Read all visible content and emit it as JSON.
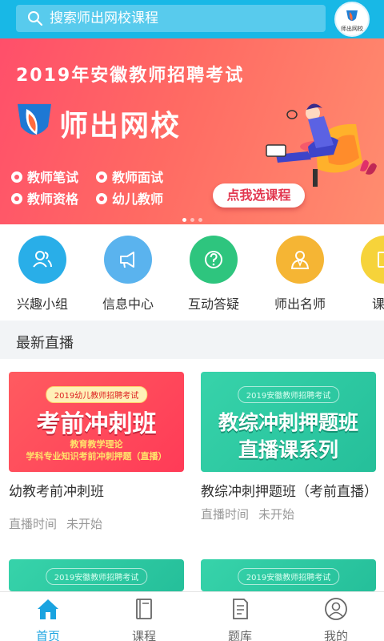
{
  "header": {
    "search_placeholder": "搜索师出网校课程",
    "avatar_text": "师出网校"
  },
  "banner": {
    "year_title": "2019年安徽教师招聘考试",
    "brand": "师出网校",
    "tags": [
      "教师笔试",
      "教师面试",
      "教师资格",
      "幼儿教师"
    ],
    "cta": "点我选课程",
    "page_count": 3,
    "active_page": 1
  },
  "categories": [
    {
      "label": "兴趣小组",
      "icon": "group-icon",
      "color": "#29aee8"
    },
    {
      "label": "信息中心",
      "icon": "megaphone-icon",
      "color": "#5ab3ee"
    },
    {
      "label": "互动答疑",
      "icon": "question-icon",
      "color": "#2ec57e"
    },
    {
      "label": "师出名师",
      "icon": "teacher-icon",
      "color": "#f5b534"
    },
    {
      "label": "课程",
      "icon": "book-icon",
      "color": "#f6d33a"
    }
  ],
  "section": {
    "title": "最新直播"
  },
  "courses": [
    {
      "thumb_pill": "2019幼儿教师招聘考试",
      "thumb_big": "考前冲刺班",
      "thumb_sub1": "教育教学理论",
      "thumb_sub2": "学科专业知识考前冲刺押题（直播）",
      "title": "幼教考前冲刺班",
      "time_label": "直播时间",
      "status": "未开始"
    },
    {
      "thumb_pill": "2019安徽教师招聘考试",
      "thumb_big": "教综冲刺押题班",
      "thumb_big2": "直播课系列",
      "title": "教综冲刺押题班（考前直播）",
      "time_label": "直播时间",
      "status": "未开始"
    },
    {
      "thumb_pill": "2019安徽教师招聘考试"
    },
    {
      "thumb_pill": "2019安徽教师招聘考试"
    }
  ],
  "nav": {
    "items": [
      {
        "label": "首页",
        "icon": "home-icon",
        "active": true
      },
      {
        "label": "课程",
        "icon": "course-book-icon",
        "active": false
      },
      {
        "label": "题库",
        "icon": "question-bank-icon",
        "active": false
      },
      {
        "label": "我的",
        "icon": "profile-icon",
        "active": false
      }
    ]
  },
  "colors": {
    "primary": "#18b8e6",
    "active_nav": "#1aa3e0",
    "banner_red": "#ff5a6a",
    "muted_text": "#999999"
  }
}
